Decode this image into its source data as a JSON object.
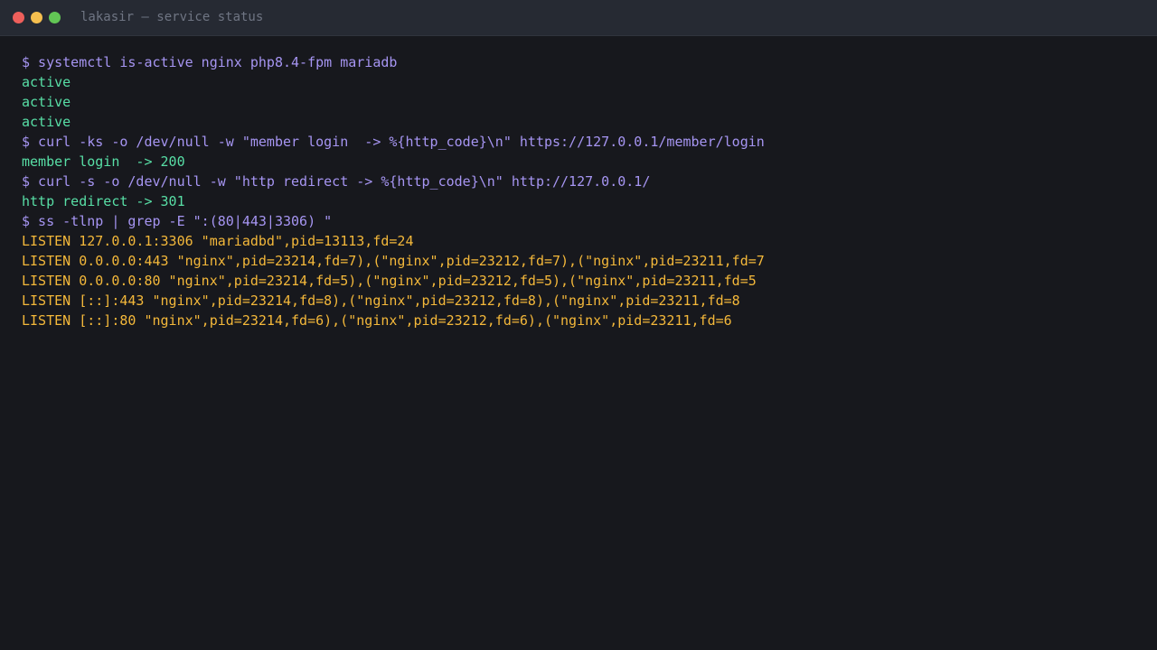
{
  "window": {
    "title": "lakasir — service status"
  },
  "colors": {
    "command": "#a695f2",
    "success": "#58dfa6",
    "listen": "#f4b83a",
    "background": "#17181d",
    "titlebar": "#262a33"
  },
  "terminal": {
    "lines": [
      "$ systemctl is-active nginx php8.4-fpm mariadb",
      "active",
      "active",
      "active",
      "$ curl -ks -o /dev/null -w \"member login  -> %{http_code}\\n\" https://127.0.0.1/member/login",
      "member login  -> 200",
      "$ curl -s -o /dev/null -w \"http redirect -> %{http_code}\\n\" http://127.0.0.1/",
      "http redirect -> 301",
      "$ ss -tlnp | grep -E \":(80|443|3306) \"",
      "LISTEN 127.0.0.1:3306 \"mariadbd\",pid=13113,fd=24",
      "LISTEN 0.0.0.0:443 \"nginx\",pid=23214,fd=7),(\"nginx\",pid=23212,fd=7),(\"nginx\",pid=23211,fd=7",
      "LISTEN 0.0.0.0:80 \"nginx\",pid=23214,fd=5),(\"nginx\",pid=23212,fd=5),(\"nginx\",pid=23211,fd=5",
      "LISTEN [::]:443 \"nginx\",pid=23214,fd=8),(\"nginx\",pid=23212,fd=8),(\"nginx\",pid=23211,fd=8",
      "LISTEN [::]:80 \"nginx\",pid=23214,fd=6),(\"nginx\",pid=23212,fd=6),(\"nginx\",pid=23211,fd=6"
    ]
  }
}
